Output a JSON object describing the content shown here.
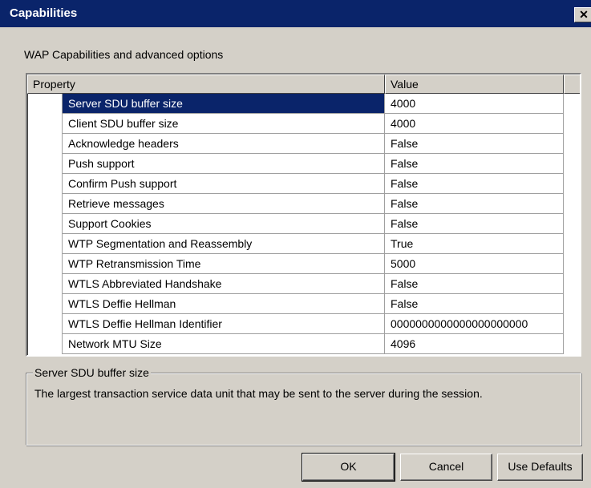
{
  "window": {
    "title": "Capabilities",
    "close_glyph": "✕",
    "close_icon": "close-icon"
  },
  "subtitle": "WAP Capabilities and advanced options",
  "grid": {
    "headers": {
      "property": "Property",
      "value": "Value"
    },
    "rows": [
      {
        "property": "Server SDU buffer size",
        "value": "4000",
        "selected": true
      },
      {
        "property": "Client SDU buffer size",
        "value": "4000"
      },
      {
        "property": "Acknowledge headers",
        "value": "False"
      },
      {
        "property": "Push support",
        "value": "False"
      },
      {
        "property": "Confirm Push support",
        "value": "False"
      },
      {
        "property": "Retrieve messages",
        "value": "False"
      },
      {
        "property": "Support Cookies",
        "value": "False"
      },
      {
        "property": "WTP Segmentation and Reassembly",
        "value": "True"
      },
      {
        "property": "WTP Retransmission Time",
        "value": "5000"
      },
      {
        "property": "WTLS Abbreviated Handshake",
        "value": "False"
      },
      {
        "property": "WTLS Deffie Hellman",
        "value": "False"
      },
      {
        "property": "WTLS Deffie Hellman Identifier",
        "value": "0000000000000000000000"
      },
      {
        "property": "Network MTU Size",
        "value": "4096"
      }
    ]
  },
  "description": {
    "title": "Server SDU buffer size",
    "text": "The largest transaction service data unit that may be sent to the server during the session."
  },
  "buttons": {
    "ok": "OK",
    "cancel": "Cancel",
    "defaults": "Use Defaults"
  },
  "colors": {
    "titlebar": "#0a246a",
    "selection": "#0a246a",
    "face": "#d4d0c8"
  }
}
